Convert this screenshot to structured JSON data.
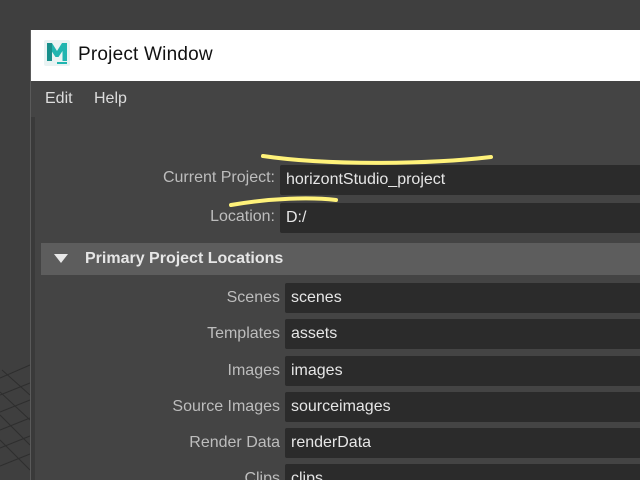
{
  "window": {
    "title": "Project Window",
    "icon": "maya-logo-icon"
  },
  "menu": {
    "edit": "Edit",
    "help": "Help"
  },
  "project": {
    "current_project_label": "Current Project:",
    "current_project_value": "horizontStudio_project",
    "location_label": "Location:",
    "location_value": "D:/"
  },
  "section": {
    "title": "Primary Project Locations",
    "expanded": true
  },
  "locations": [
    {
      "label": "Scenes",
      "value": "scenes"
    },
    {
      "label": "Templates",
      "value": "assets"
    },
    {
      "label": "Images",
      "value": "images"
    },
    {
      "label": "Source Images",
      "value": "sourceimages"
    },
    {
      "label": "Render Data",
      "value": "renderData"
    },
    {
      "label": "Clips",
      "value": "clips"
    }
  ],
  "colors": {
    "highlight": "#fff27a",
    "field_bg": "#2b2b2b",
    "section_bg": "#5d5d5d",
    "maya_teal": "#1fb5b0"
  }
}
